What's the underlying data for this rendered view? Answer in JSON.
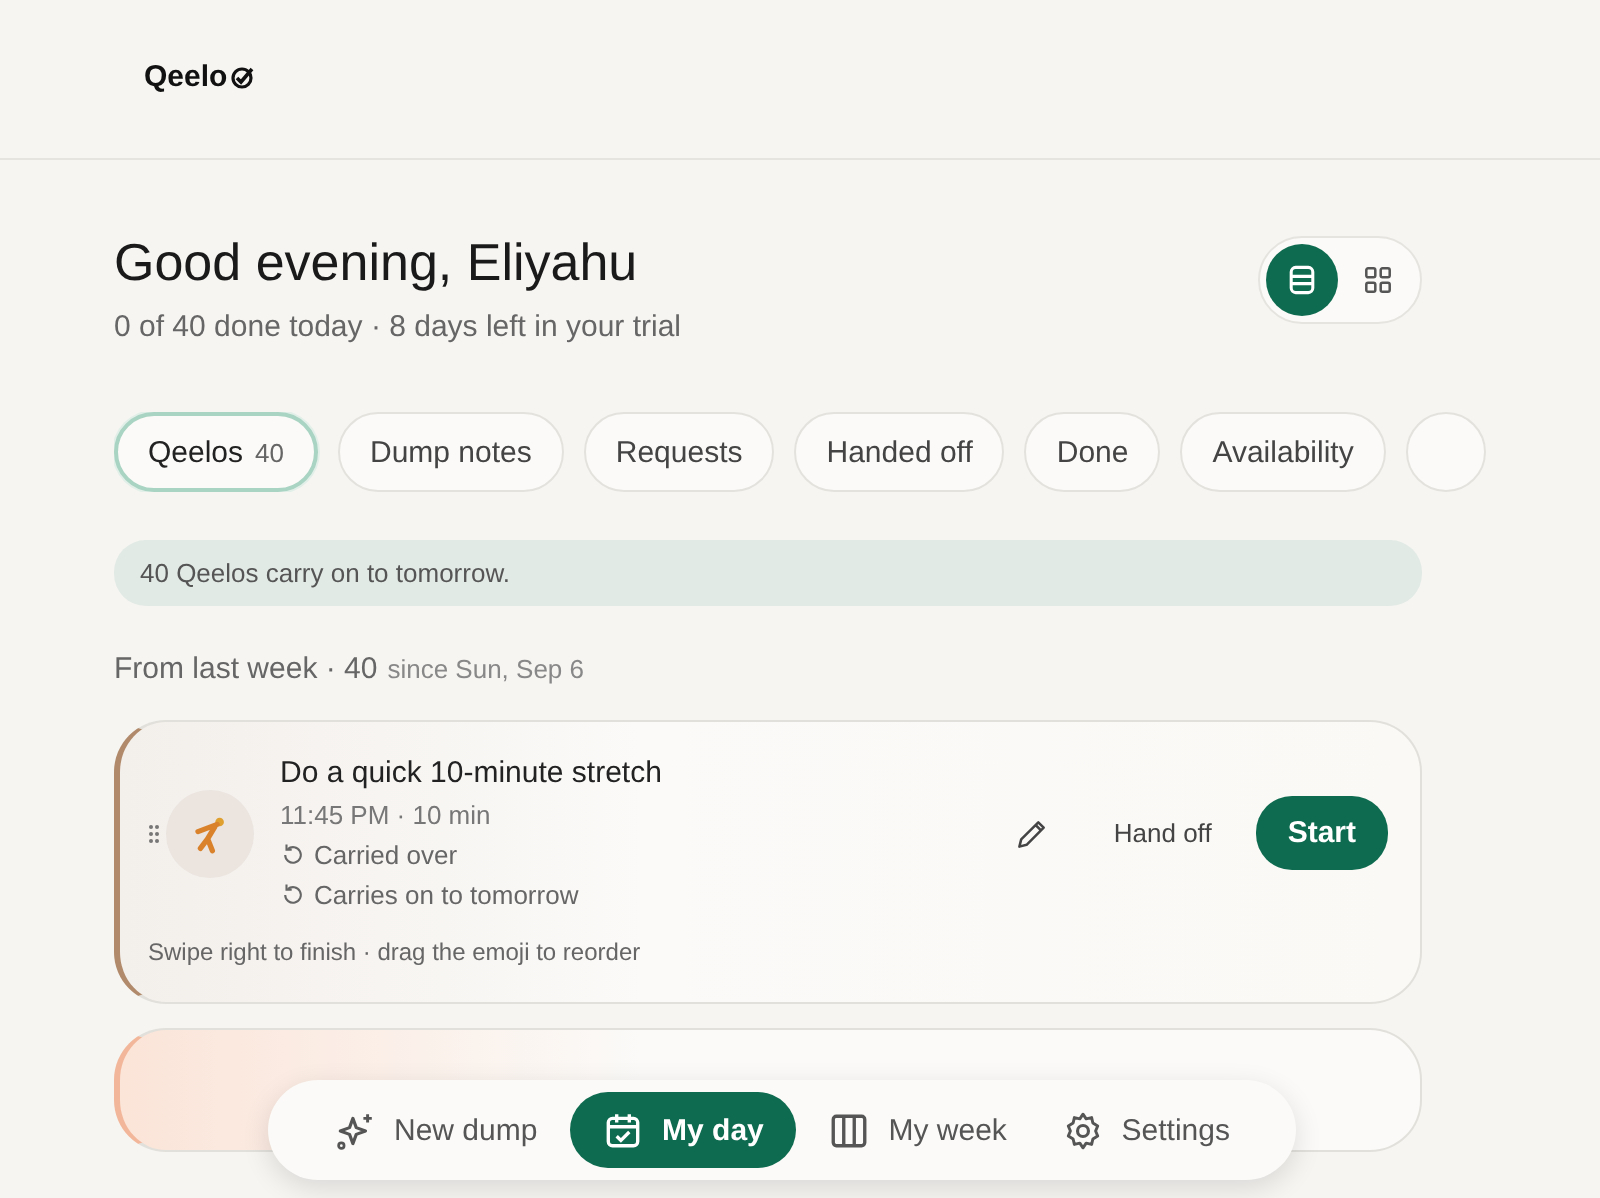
{
  "logo": {
    "text": "Qeelo"
  },
  "greeting": "Good evening, Eliyahu",
  "summary": "0 of 40 done today · 8 days left in your trial",
  "view_toggle": [
    {
      "kind": "list",
      "selected": true
    },
    {
      "kind": "grid",
      "selected": false
    }
  ],
  "filters": [
    {
      "label": "Qeelos",
      "count": "40",
      "selected": true
    },
    {
      "label": "Dump notes",
      "selected": false
    },
    {
      "label": "Requests",
      "selected": false
    },
    {
      "label": "Handed off",
      "selected": false
    },
    {
      "label": "Done",
      "selected": false
    },
    {
      "label": "Availability",
      "selected": false
    }
  ],
  "banner": "40 Qeelos carry on to tomorrow.",
  "section": {
    "title": "From last week · 40",
    "note": "since Sun, Sep 6"
  },
  "tasks": [
    {
      "title": "Do a quick 10-minute stretch",
      "meta": "11:45 PM · 10 min",
      "tags": [
        "Carried over",
        "Carries on to tomorrow"
      ],
      "hint": "Swipe right to finish · drag the emoji to reorder",
      "actions": {
        "handoff": "Hand off",
        "start": "Start"
      }
    }
  ],
  "nav": [
    {
      "kind": "sparkle",
      "label": "New dump",
      "selected": false
    },
    {
      "kind": "calendar",
      "label": "My day",
      "selected": true
    },
    {
      "kind": "columns",
      "label": "My week",
      "selected": false
    },
    {
      "kind": "gear",
      "label": "Settings",
      "selected": false
    }
  ]
}
